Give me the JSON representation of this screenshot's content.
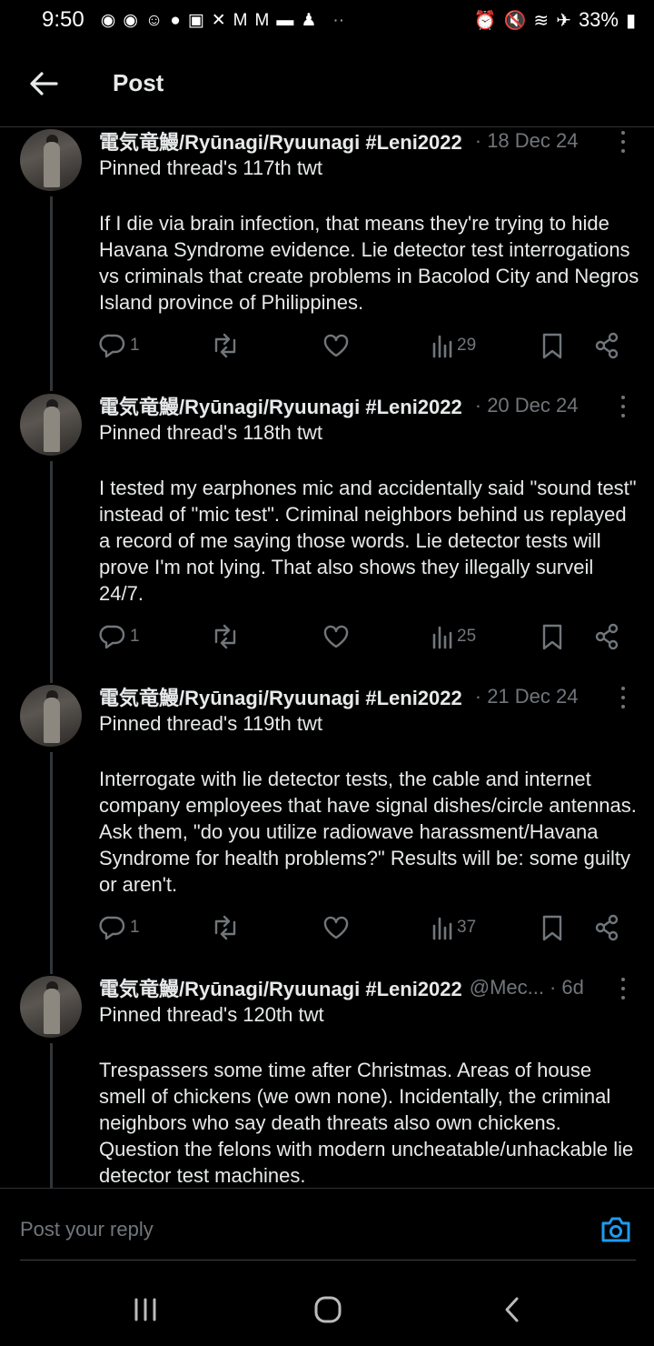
{
  "status_bar": {
    "time": "9:50",
    "left_icons": [
      "messenger-icon",
      "messenger-icon",
      "face-icon",
      "reddit-icon",
      "twitch-icon",
      "x-icon",
      "gmail-icon",
      "gmail-icon",
      "chat-icon",
      "person-icon",
      "more-dots-icon"
    ],
    "battery": "33%"
  },
  "header": {
    "title": "Post"
  },
  "tweets": [
    {
      "author": "電気竜鰻/Ryūnagi/Ryuunagi #Leni2022",
      "handle": "",
      "date": "· 18 Dec 24",
      "subtitle": "Pinned thread's 117th twt",
      "text": "If I die via brain infection, that means they're trying to hide Havana Syndrome evidence. Lie detector test interrogations vs  criminals that create problems in Bacolod City and Negros Island province of Philippines.",
      "replies": "1",
      "views": "29"
    },
    {
      "author": "電気竜鰻/Ryūnagi/Ryuunagi #Leni2022",
      "handle": "",
      "date": "· 20 Dec 24",
      "subtitle": "Pinned thread's 118th twt",
      "text": "I tested my earphones mic and accidentally said \"sound test\" instead of \"mic test\". Criminal neighbors behind us replayed a record of me saying those words. Lie detector tests will prove I'm not lying. That also shows they illegally surveil 24/7.",
      "replies": "1",
      "views": "25"
    },
    {
      "author": "電気竜鰻/Ryūnagi/Ryuunagi #Leni2022",
      "handle": "",
      "date": "· 21 Dec 24",
      "subtitle": "Pinned thread's 119th twt",
      "text": "Interrogate with lie detector tests, the cable and internet company employees that have signal dishes/circle antennas. Ask them, \"do you utilize radiowave harassment/Havana Syndrome for health problems?\" Results will be: some guilty or aren't.",
      "replies": "1",
      "views": "37"
    },
    {
      "author": "電気竜鰻/Ryūnagi/Ryuunagi #Leni2022",
      "handle": "@Mec...",
      "date": "· 6d",
      "subtitle": "Pinned thread's 120th twt",
      "text": "Trespassers some time after Christmas. Areas of house smell of chickens (we own none). Incidentally, the criminal neighbors who say death threats also own chickens. Question the felons with modern uncheatable/unhackable lie detector test machines.",
      "replies": "",
      "views": ""
    }
  ],
  "reply": {
    "placeholder": "Post your reply"
  },
  "colors": {
    "background": "#000000",
    "text": "#e7e9ea",
    "muted": "#71767b",
    "accent": "#1d9bf0",
    "divider": "#2f3336"
  }
}
